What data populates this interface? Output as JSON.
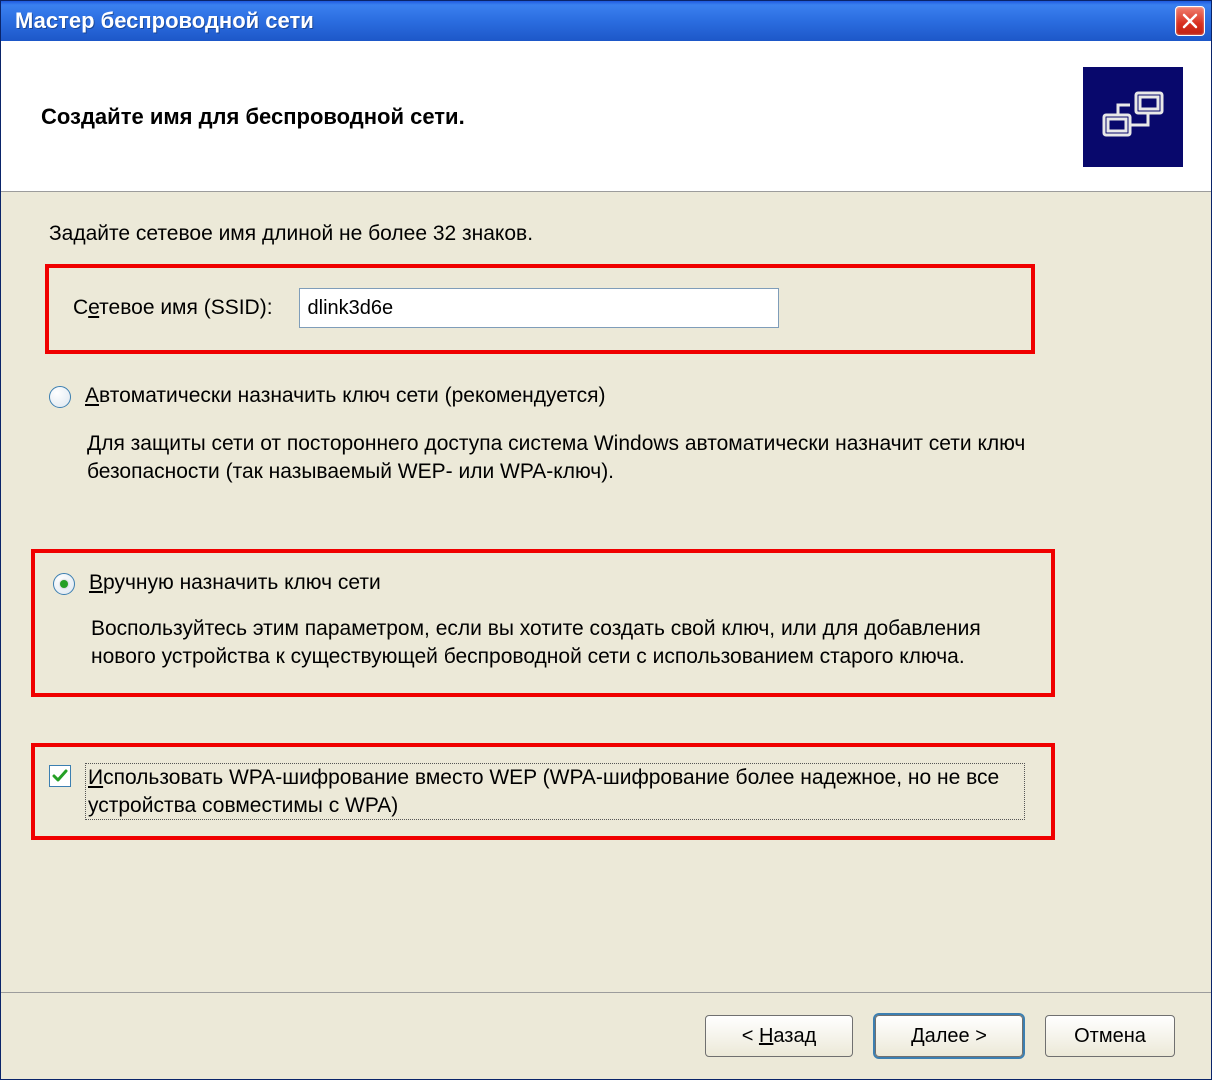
{
  "window": {
    "title": "Мастер беспроводной сети"
  },
  "header": {
    "heading": "Создайте имя для беспроводной сети."
  },
  "content": {
    "instruction": "Задайте сетевое имя длиной не более 32 знаков.",
    "ssid": {
      "label_pre": "С",
      "label_u": "е",
      "label_post": "тевое имя (SSID):",
      "value": "dlink3d6e"
    },
    "auto": {
      "checked": false,
      "label_u": "А",
      "label_post": "втоматически назначить ключ сети (рекомендуется)",
      "desc": "Для защиты сети от постороннего доступа система Windows автоматически назначит сети ключ безопасности (так называемый WEP- или WPA-ключ)."
    },
    "manual": {
      "checked": true,
      "label_u": "В",
      "label_post": "ручную назначить ключ сети",
      "desc": "Воспользуйтесь этим параметром, если вы хотите создать свой ключ, или для добавления нового устройства к существующей беспроводной сети с использованием старого ключа."
    },
    "wpa": {
      "checked": true,
      "label_u": "И",
      "label_post": "спользовать WPA-шифрование вместо WEP (WPA-шифрование более надежное, но не все устройства совместимы с WPA)"
    }
  },
  "footer": {
    "back_pre": "< ",
    "back_u": "Н",
    "back_post": "азад",
    "next_u": "Д",
    "next_post": "алее >",
    "cancel": "Отмена"
  }
}
